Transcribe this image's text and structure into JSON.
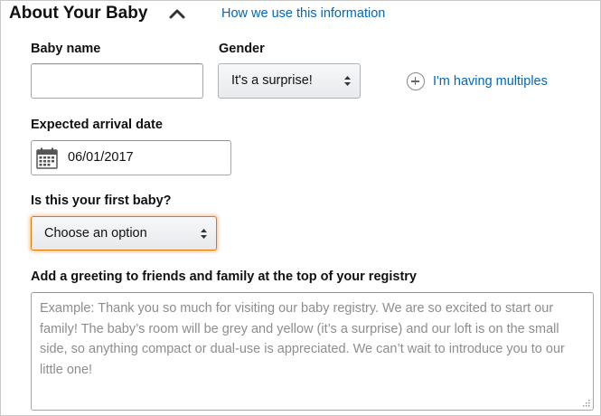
{
  "section": {
    "title": "About Your Baby",
    "info_link": "How we use this information"
  },
  "baby_name": {
    "label": "Baby name",
    "value": ""
  },
  "gender": {
    "label": "Gender",
    "selected": "It's a surprise!"
  },
  "multiples": {
    "label": "I'm having multiples"
  },
  "arrival": {
    "label": "Expected arrival date",
    "value": "06/01/2017"
  },
  "first_baby": {
    "label": "Is this your first baby?",
    "selected": "Choose an option"
  },
  "greeting": {
    "label": "Add a greeting to friends and family at the top of your registry",
    "placeholder": "Example: Thank you so much for visiting our baby registry.  We are so excited to start our family!  The baby’s room will be grey and yellow (it’s a surprise) and our loft is on the small side, so anything compact or dual-use is appreciated.  We can’t wait to introduce you to our little one!"
  },
  "colors": {
    "link": "#0066c0",
    "focus_border": "#e77600"
  },
  "icons": [
    "chevron-up-icon",
    "select-arrows-icon",
    "plus-circle-icon",
    "calendar-icon",
    "resize-grip-icon"
  ]
}
